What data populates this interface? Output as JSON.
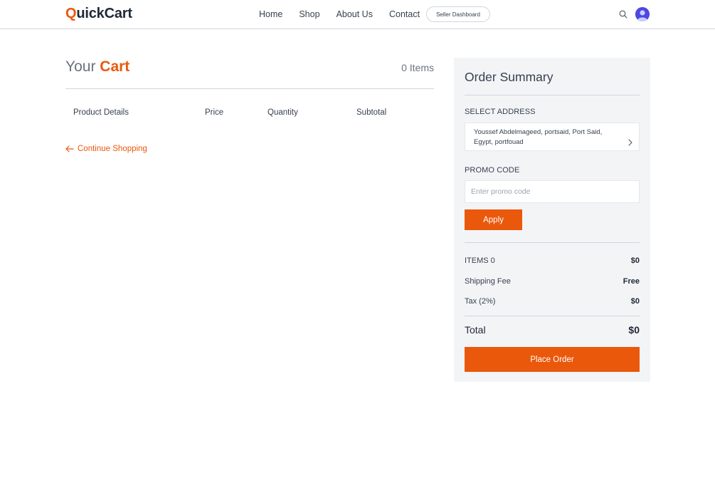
{
  "header": {
    "logo_first": "Q",
    "logo_rest": "uickCart",
    "nav": {
      "home": "Home",
      "shop": "Shop",
      "about": "About Us",
      "contact": "Contact"
    },
    "seller_dashboard": "Seller Dashboard",
    "icons": {
      "search": "search-icon",
      "user": "avatar"
    }
  },
  "cart": {
    "title_prefix": "Your",
    "title_accent": "Cart",
    "items_count": "0 Items",
    "columns": [
      "Product Details",
      "Price",
      "Quantity",
      "Subtotal"
    ],
    "continue_shopping": "Continue Shopping"
  },
  "summary": {
    "title": "Order Summary",
    "select_address_label": "SELECT ADDRESS",
    "address": "Youssef Abdelmageed, portsaid, Port Said, Egypt, portfouad",
    "promo_label": "PROMO CODE",
    "promo_placeholder": "Enter promo code",
    "apply": "Apply",
    "items_label": "ITEMS 0",
    "items_value": "$0",
    "shipping_label": "Shipping Fee",
    "shipping_value": "Free",
    "tax_label": "Tax (2%)",
    "tax_value": "$0",
    "total_label": "Total",
    "total_value": "$0",
    "place_order": "Place Order"
  },
  "colors": {
    "accent": "#ea580c",
    "summary_bg": "#f3f4f6",
    "avatar": "#4f46e5"
  }
}
